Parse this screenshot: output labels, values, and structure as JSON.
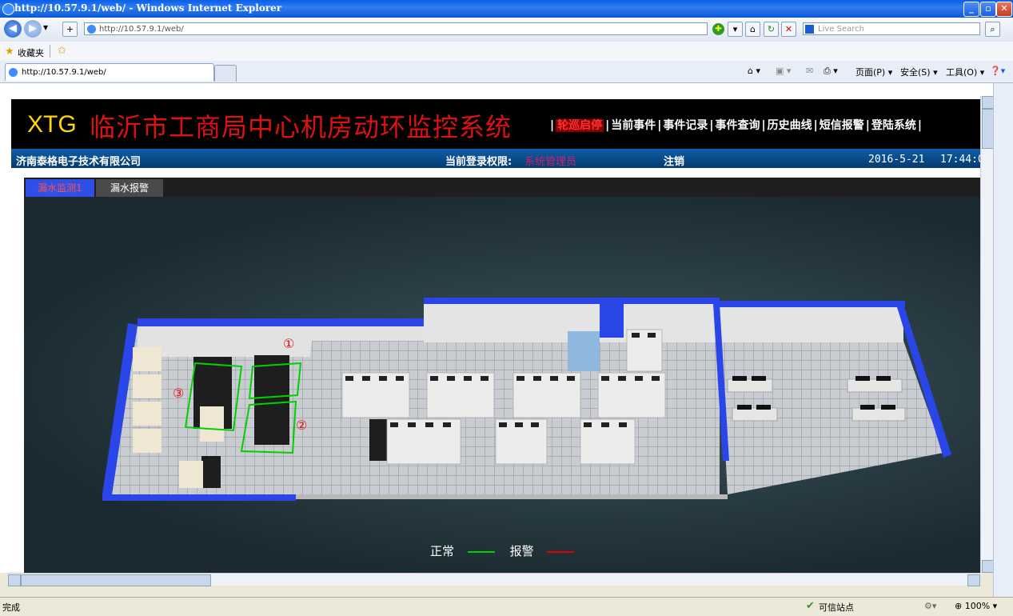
{
  "browser": {
    "title": "http://10.57.9.1/web/ - Windows Internet Explorer",
    "address": "http://10.57.9.1/web/",
    "search_placeholder": "Live Search",
    "favorites_label": "收藏夹",
    "tab_title": "http://10.57.9.1/web/",
    "commands": {
      "page": "页面(P)",
      "safety": "安全(S)",
      "tools": "工具(O)"
    },
    "status": {
      "left": "完成",
      "zone": "可信站点",
      "zoom": "100%"
    }
  },
  "app": {
    "logo": "XTG",
    "title": "临沂市工商局中心机房动环监控系统",
    "menu": [
      "轮巡启停",
      "当前事件",
      "事件记录",
      "事件查询",
      "历史曲线",
      "短信报警",
      "登陆系统"
    ],
    "company": "济南泰格电子技术有限公司",
    "login_label": "当前登录权限:",
    "login_role": "系统管理员",
    "logout": "注销",
    "date": "2016-5-21",
    "time": "17:44:0",
    "tabs": [
      "漏水监测1",
      "漏水报警"
    ],
    "zones": [
      "①",
      "②",
      "③"
    ],
    "legend": {
      "normal": "正常",
      "alarm": "报警",
      "normal_color": "#00d000",
      "alarm_color": "#e00000"
    }
  }
}
